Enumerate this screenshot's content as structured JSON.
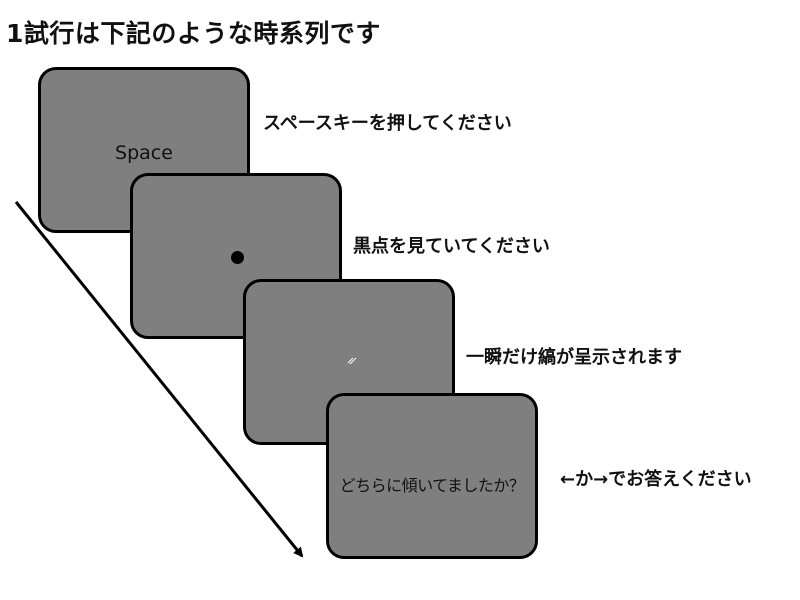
{
  "title": "1試行は下記のような時系列です",
  "screens": [
    {
      "text": "Space",
      "label": "スペースキーを押してください"
    },
    {
      "text": "",
      "label": "黒点を見ていてください"
    },
    {
      "text": "",
      "label": "一瞬だけ縞が呈示されます"
    },
    {
      "text": "どちらに傾いてましたか？",
      "label": "←か→でお答えください"
    }
  ],
  "colors": {
    "screen_fill": "#7f7f7f",
    "border": "#000000",
    "text": "#111111"
  }
}
